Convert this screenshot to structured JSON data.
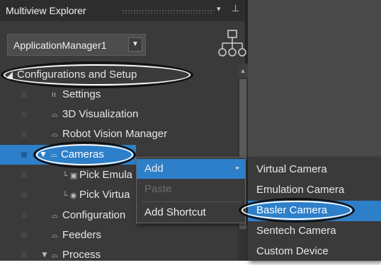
{
  "panel": {
    "title": "Multiview Explorer",
    "dropdown_glyph": "▾",
    "pin_glyph": "⊥"
  },
  "app_selector": {
    "value": "ApplicationManager1",
    "arrow": "▼"
  },
  "tree": {
    "rows": [
      {
        "label": "Configurations and Setup",
        "icon": "◢"
      },
      {
        "label": "Settings",
        "icon": "ıı"
      },
      {
        "label": "3D Visualization",
        "icon": "⌓"
      },
      {
        "label": "Robot Vision Manager",
        "icon": "⌓"
      },
      {
        "label": "Cameras",
        "icon": "⌓",
        "expander": "▼"
      },
      {
        "label": "Pick Emula",
        "icon": "└ ▣"
      },
      {
        "label": "Pick Virtua",
        "icon": "└ ◉"
      },
      {
        "label": "Configuration",
        "icon": "⌓"
      },
      {
        "label": "Feeders",
        "icon": "⌓"
      },
      {
        "label": "Process",
        "icon": "⌓",
        "expander": "▼"
      }
    ]
  },
  "context_menu": {
    "items": [
      {
        "label": "Add",
        "arrow": "▸"
      },
      {
        "label": "Paste"
      },
      {
        "label": "Add Shortcut"
      }
    ]
  },
  "submenu": {
    "items": [
      {
        "label": "Virtual Camera"
      },
      {
        "label": "Emulation Camera"
      },
      {
        "label": "Basler Camera"
      },
      {
        "label": "Sentech Camera"
      },
      {
        "label": "Custom Device"
      }
    ]
  },
  "colors": {
    "panel_bg": "#3a3a3a",
    "selection": "#2e7fc9",
    "annotation": "#111111"
  }
}
